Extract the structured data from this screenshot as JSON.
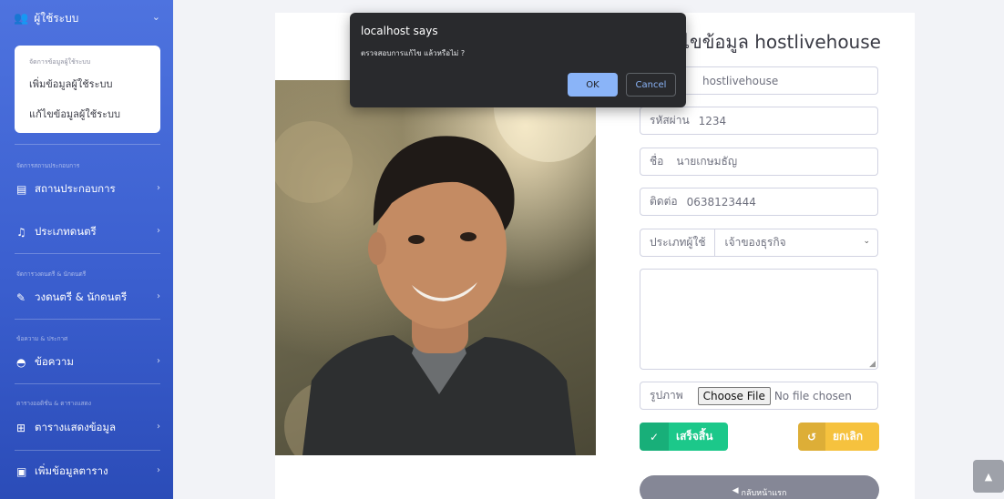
{
  "sidebar": {
    "top_item": {
      "label": "ผู้ใช้ระบบ",
      "icon": "users-cog-icon"
    },
    "submenu": {
      "header": "จัดการข้อมูลผู้ใช้ระบบ",
      "items": [
        "เพิ่มข้อมูลผู้ใช้ระบบ",
        "แก้ไขข้อมูลผู้ใช้ระบบ"
      ]
    },
    "sections": [
      {
        "heading": "จัดการสถานประกอบการ",
        "item": "สถานประกอบการ",
        "icon": "store-icon"
      },
      {
        "heading": "",
        "item": "ประเภทดนตรี",
        "icon": "music-icon"
      },
      {
        "heading": "จัดการวงดนตรี & นักดนตรี",
        "item": "วงดนตรี & นักดนตรี",
        "icon": "guitar-icon"
      },
      {
        "heading": "ข้อความ & ประกาศ",
        "item": "ข้อความ",
        "icon": "message-icon"
      },
      {
        "heading": "ตารางออดิชั่น & ตารางแสดง",
        "item": "ตารางแสดงข้อมูล",
        "icon": "table-icon"
      },
      {
        "heading": "",
        "item": "เพิ่มข้อมูลตาราง",
        "icon": "add-table-icon"
      }
    ]
  },
  "form": {
    "title": "ไขข้อมูล hostlivehouse",
    "username_value": "hostlivehouse",
    "password": {
      "label": "รหัสผ่าน",
      "value": "1234"
    },
    "name": {
      "label": "ชื่อ",
      "value": "นายเกษมธัญ"
    },
    "contact": {
      "label": "ติดต่อ",
      "value": "0638123444"
    },
    "user_type": {
      "label": "ประเภทผู้ใช้",
      "selected": "เจ้าของธุรกิจ"
    },
    "image": {
      "label": "รูปภาพ",
      "choose_label": "Choose File",
      "no_file": "No file chosen"
    },
    "done_label": "เสร็จสิ้น",
    "cancel_label": "ยกเลิก",
    "home_label": "กลับหน้าแรก"
  },
  "dialog": {
    "title": "localhost says",
    "message": "ตรวจสอบการแก้ไข แล้วหรือไม่ ?",
    "ok_label": "OK",
    "cancel_label": "Cancel"
  },
  "colors": {
    "sidebar": "#4e73df",
    "success": "#1cc88a",
    "warning": "#f6c23e",
    "secondary": "#858796",
    "dialog_bg": "#292a2d",
    "dialog_accent": "#8ab4f8"
  }
}
